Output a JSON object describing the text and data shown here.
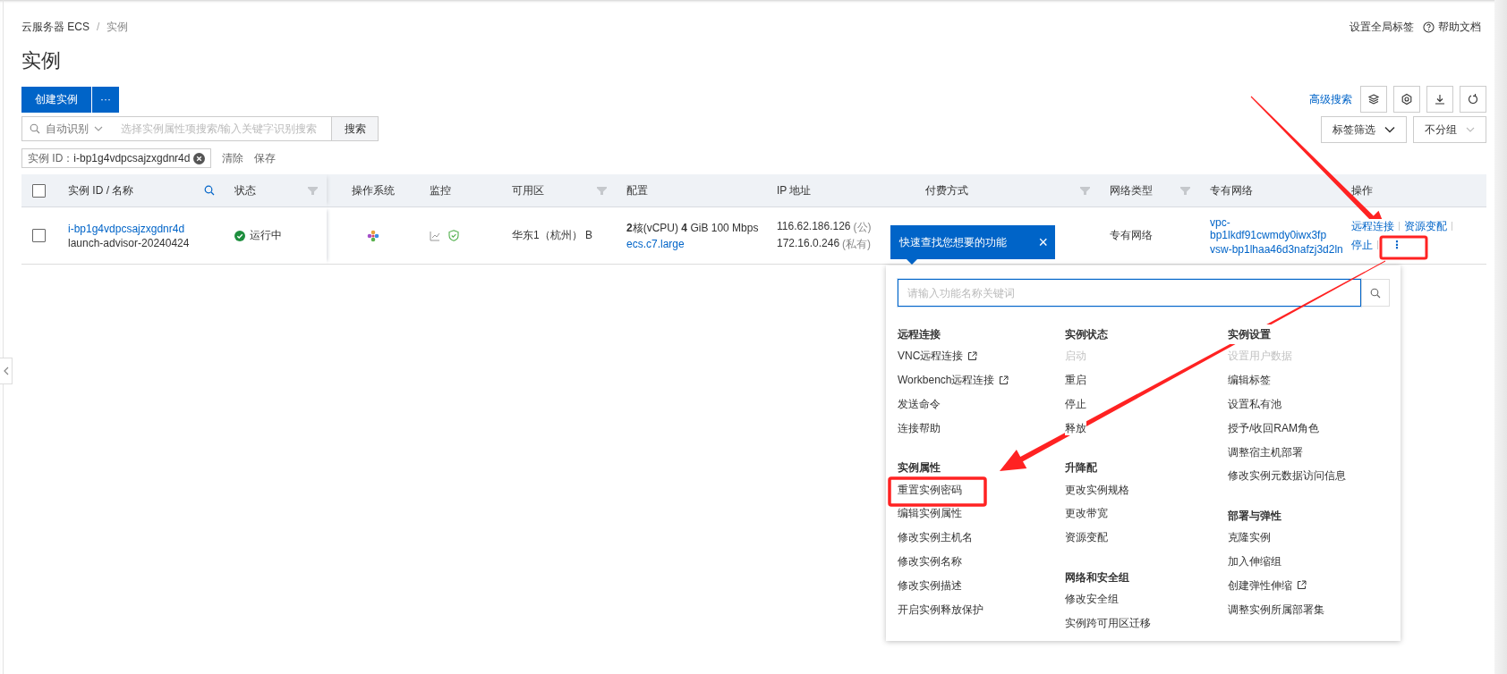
{
  "breadcrumb": [
    "云服务器 ECS",
    "实例"
  ],
  "breadcrumb_separator": "/",
  "header_links": [
    "设置全局标签",
    "帮助文档"
  ],
  "page_title": "实例",
  "create_button": "创建实例",
  "more_button": "···",
  "advanced_search": "高级搜索",
  "search": {
    "scope": "自动识别",
    "placeholder": "选择实例属性项搜索/输入关键字识别搜索",
    "button": "搜索"
  },
  "tag_filter": "标签筛选",
  "group_select": "不分组",
  "filter_tag": {
    "label": "实例 ID：",
    "value": "i-bp1g4vdpcsajzxgdnr4d"
  },
  "filter_actions": [
    "清除",
    "保存"
  ],
  "table": {
    "select_all_checked": false,
    "columns": [
      {
        "label": "实例 ID / 名称",
        "kind": "search"
      },
      {
        "label": "状态",
        "kind": "filter"
      },
      {
        "label": "操作系统",
        "kind": "plain"
      },
      {
        "label": "监控",
        "kind": "plain"
      },
      {
        "label": "可用区",
        "kind": "filter"
      },
      {
        "label": "配置",
        "kind": "plain"
      },
      {
        "label": "IP 地址",
        "kind": "plain"
      },
      {
        "label": "付费方式",
        "kind": "filter"
      },
      {
        "label": "网络类型",
        "kind": "filter"
      },
      {
        "label": "专有网络",
        "kind": "plain"
      },
      {
        "label": "操作",
        "kind": "plain"
      }
    ],
    "rows": [
      {
        "checked": false,
        "id": "i-bp1g4vdpcsajzxgdnr4d",
        "name": "launch-advisor-20240424",
        "status": "运行中",
        "zone": "华东1（杭州） B",
        "config": "**2**核(vCPU)  **4** GiB 100 Mbps",
        "spec": "ecs.c7.large",
        "ips": [
          {
            "ip": "116.62.186.126",
            "tag": "(公)"
          },
          {
            "ip": "172.16.0.246",
            "tag": "(私有)"
          }
        ],
        "network_type": "专有网络",
        "vpc": "vpc-bp1lkdf91cwmdy0iwx3fp",
        "vswitch": "vsw-bp1lhaa46d3nafzj3d2ln",
        "actions": [
          "远程连接",
          "资源变配",
          "停止"
        ],
        "more": "⋮"
      }
    ]
  },
  "tooltip": {
    "text": "快速查找您想要的功能",
    "close": "×"
  },
  "action_menu": {
    "placeholder": "请输入功能名称关键词",
    "columns": [
      [
        {
          "title": "远程连接",
          "items": [
            {
              "label": "VNC远程连接",
              "disabled": false,
              "external": true
            },
            {
              "label": "Workbench远程连接",
              "disabled": false,
              "external": true
            },
            {
              "label": "发送命令",
              "disabled": false,
              "external": false
            },
            {
              "label": "连接帮助",
              "disabled": false,
              "external": false
            }
          ]
        },
        {
          "title": "实例属性",
          "items": [
            {
              "label": "重置实例密码",
              "disabled": false,
              "external": false
            },
            {
              "label": "编辑实例属性",
              "disabled": false,
              "external": false
            },
            {
              "label": "修改实例主机名",
              "disabled": false,
              "external": false
            },
            {
              "label": "修改实例名称",
              "disabled": false,
              "external": false
            },
            {
              "label": "修改实例描述",
              "disabled": false,
              "external": false
            },
            {
              "label": "开启实例释放保护",
              "disabled": false,
              "external": false
            }
          ]
        }
      ],
      [
        {
          "title": "实例状态",
          "items": [
            {
              "label": "启动",
              "disabled": true,
              "external": false
            },
            {
              "label": "重启",
              "disabled": false,
              "external": false
            },
            {
              "label": "停止",
              "disabled": false,
              "external": false
            },
            {
              "label": "释放",
              "disabled": false,
              "external": false
            }
          ]
        },
        {
          "title": "升降配",
          "items": [
            {
              "label": "更改实例规格",
              "disabled": false,
              "external": false
            },
            {
              "label": "更改带宽",
              "disabled": false,
              "external": false
            },
            {
              "label": "资源变配",
              "disabled": false,
              "external": false
            }
          ]
        },
        {
          "title": "网络和安全组",
          "items": [
            {
              "label": "修改安全组",
              "disabled": false,
              "external": false
            },
            {
              "label": "实例跨可用区迁移",
              "disabled": false,
              "external": false
            }
          ]
        }
      ],
      [
        {
          "title": "实例设置",
          "items": [
            {
              "label": "设置用户数据",
              "disabled": true,
              "external": false
            },
            {
              "label": "编辑标签",
              "disabled": false,
              "external": false
            },
            {
              "label": "设置私有池",
              "disabled": false,
              "external": false
            },
            {
              "label": "授予/收回RAM角色",
              "disabled": false,
              "external": false
            },
            {
              "label": "调整宿主机部署",
              "disabled": false,
              "external": false
            },
            {
              "label": "修改实例元数据访问信息",
              "disabled": false,
              "external": false
            }
          ]
        },
        {
          "title": "部署与弹性",
          "items": [
            {
              "label": "克隆实例",
              "disabled": false,
              "external": false
            },
            {
              "label": "加入伸缩组",
              "disabled": false,
              "external": false
            },
            {
              "label": "创建弹性伸缩",
              "disabled": false,
              "external": true
            },
            {
              "label": "调整实例所属部署集",
              "disabled": false,
              "external": false
            }
          ]
        }
      ]
    ]
  }
}
